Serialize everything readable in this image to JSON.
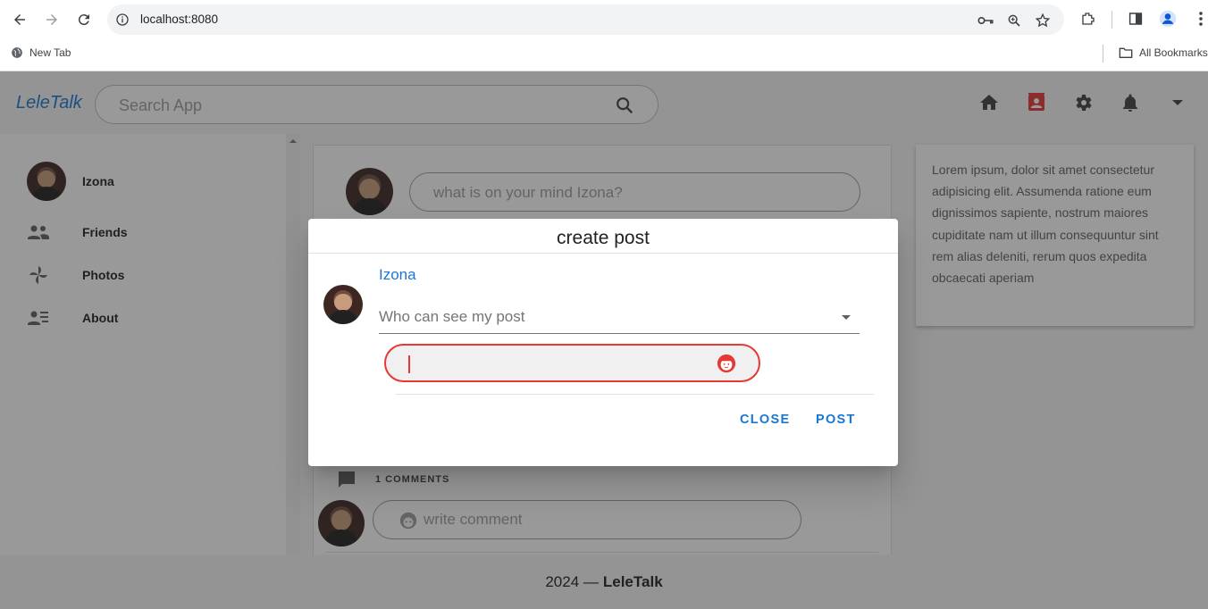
{
  "browser": {
    "url": "localhost:8080",
    "bookmarks": [
      {
        "label": "New Tab",
        "icon": "globe-icon"
      }
    ],
    "all_bookmarks_label": "All Bookmarks"
  },
  "app": {
    "brand": "LeleTalk",
    "search_placeholder": "Search App",
    "nav_icons": [
      "home-icon",
      "contacts-icon",
      "gear-icon",
      "bell-icon",
      "chevron-down-icon"
    ],
    "active_nav_color": "#e53935",
    "accent_color": "#1976d2"
  },
  "sidebar": {
    "user": "Izona",
    "items": [
      {
        "label": "Friends",
        "icon": "people-icon"
      },
      {
        "label": "Photos",
        "icon": "pinwheel-icon"
      },
      {
        "label": "About",
        "icon": "contact-list-icon"
      }
    ]
  },
  "feed": {
    "mind_placeholder": "what is on your mind Izona?",
    "comments_count": "1 COMMENTS",
    "comment_placeholder": "write comment"
  },
  "aside": {
    "text": "Lorem ipsum, dolor sit amet consectetur adipisicing elit. Assumenda ratione eum dignissimos sapiente, nostrum maiores cupiditate nam ut illum consequuntur sint rem alias deleniti, rerum quos expedita obcaecati aperiam"
  },
  "footer": {
    "year": "2024 —",
    "brand": "LeleTalk"
  },
  "dialog": {
    "title": "create post",
    "username": "Izona",
    "visibility_placeholder": "Who can see my post",
    "post_input_value": "",
    "close_label": "CLOSE",
    "post_label": "POST",
    "error_color": "#e53935"
  }
}
